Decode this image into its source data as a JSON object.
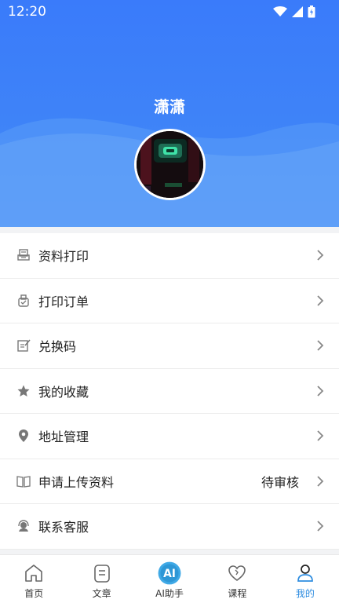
{
  "status_bar": {
    "time": "12:20"
  },
  "profile": {
    "username": "潇潇"
  },
  "menu": [
    {
      "label": "资料打印",
      "value": "",
      "icon": "printer-doc-icon"
    },
    {
      "label": "打印订单",
      "value": "",
      "icon": "print-order-icon"
    },
    {
      "label": "兑换码",
      "value": "",
      "icon": "edit-note-icon"
    },
    {
      "label": "我的收藏",
      "value": "",
      "icon": "star-icon"
    },
    {
      "label": "地址管理",
      "value": "",
      "icon": "location-pin-icon"
    },
    {
      "label": "申请上传资料",
      "value": "待审核",
      "icon": "open-book-icon"
    },
    {
      "label": "联系客服",
      "value": "",
      "icon": "customer-service-icon"
    }
  ],
  "tabbar": {
    "active": "我的",
    "items": [
      {
        "label": "首页",
        "icon": "home-icon"
      },
      {
        "label": "文章",
        "icon": "article-icon"
      },
      {
        "label": "AI助手",
        "icon": "ai-assistant-icon",
        "icon_text": "AI"
      },
      {
        "label": "课程",
        "icon": "heart-icon"
      },
      {
        "label": "我的",
        "icon": "profile-icon"
      }
    ]
  },
  "colors": {
    "header": "#3f84f8",
    "tab_active": "#2f8de0",
    "ai_badge": "#3fa9e6"
  }
}
